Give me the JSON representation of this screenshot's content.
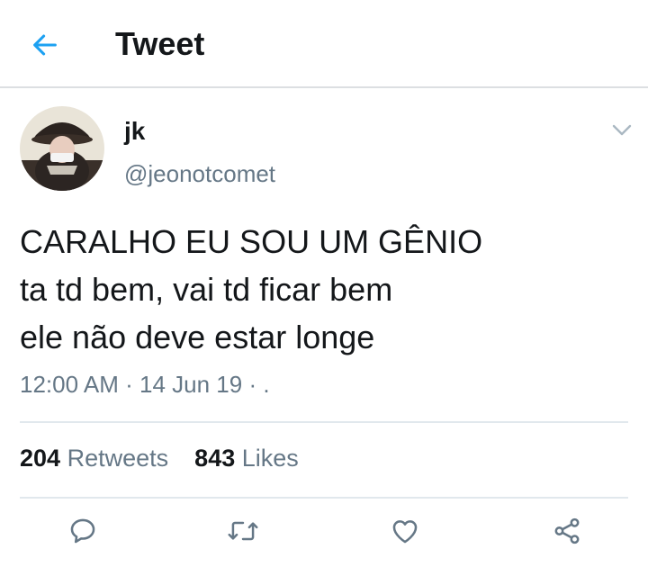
{
  "header": {
    "title": "Tweet",
    "back_icon": "arrow-left-icon",
    "accent_color": "#1da1f2"
  },
  "tweet": {
    "author_name": "jk",
    "author_handle": "@jeonotcomet",
    "text_lines": [
      "CARALHO EU SOU UM GÊNIO",
      "ta td bem, vai td ficar bem",
      "ele não deve estar longe"
    ],
    "time": "12:00 AM",
    "separator1": "·",
    "date": "14 Jun 19",
    "separator2": "·",
    "source": "."
  },
  "stats": {
    "retweets_count": "204",
    "retweets_label": "Retweets",
    "likes_count": "843",
    "likes_label": "Likes"
  },
  "actions": {
    "reply_icon": "reply-icon",
    "retweet_icon": "retweet-icon",
    "like_icon": "heart-icon",
    "share_icon": "share-icon"
  },
  "colors": {
    "text_primary": "#14171a",
    "text_secondary": "#657786",
    "divider": "#e1e8ed"
  }
}
